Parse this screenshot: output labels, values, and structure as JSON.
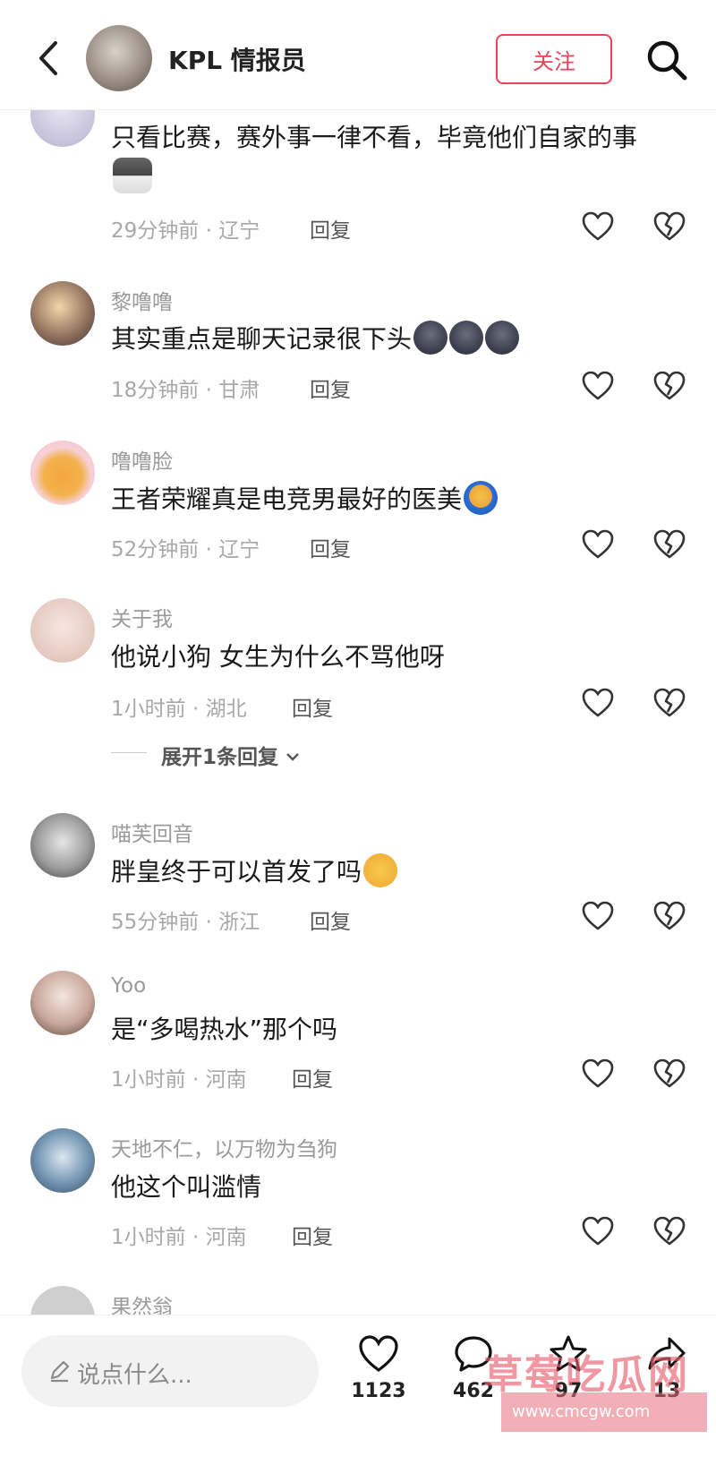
{
  "header": {
    "title": "KPL 情报员",
    "follow_label": "关注"
  },
  "comments": [
    {
      "name": "",
      "text": "只看比赛，赛外事一律不看，毕竟他们自家的事",
      "time": "29分钟前 · 辽宁",
      "reply": "回复",
      "emoji": "wolf-emoji"
    },
    {
      "name": "黎噜噜",
      "text": "其实重点是聊天记录很下头",
      "time": "18分钟前 · 甘肃",
      "reply": "回复",
      "emoji": "dark-face-emoji"
    },
    {
      "name": "噜噜脸",
      "text": "王者荣耀真是电竞男最好的医美",
      "time": "52分钟前 · 辽宁",
      "reply": "回复",
      "emoji": "blue-hair-emoji"
    },
    {
      "name": "关于我",
      "text": "他说小狗 女生为什么不骂他呀",
      "time": "1小时前 · 湖北",
      "reply": "回复",
      "expand": "展开1条回复"
    },
    {
      "name": "喵芙回音",
      "text": "胖皇终于可以首发了吗",
      "time": "55分钟前 · 浙江",
      "reply": "回复",
      "emoji": "crying-emoji"
    },
    {
      "name": "Yoo",
      "text": "是“多喝热水”那个吗",
      "time": "1小时前 · 河南",
      "reply": "回复"
    },
    {
      "name": "天地不仁，以万物为刍狗",
      "text": "他这个叫滥情",
      "time": "1小时前 · 河南",
      "reply": "回复"
    },
    {
      "name": "果然翁",
      "text": "",
      "time": "",
      "reply": ""
    }
  ],
  "bottom_bar": {
    "input_placeholder": "说点什么...",
    "like_count": "1123",
    "comment_count": "462",
    "star_count": "97",
    "share_count": "13"
  },
  "watermark": {
    "text": "草莓吃瓜网",
    "sub": "www.cmcgw.com"
  }
}
